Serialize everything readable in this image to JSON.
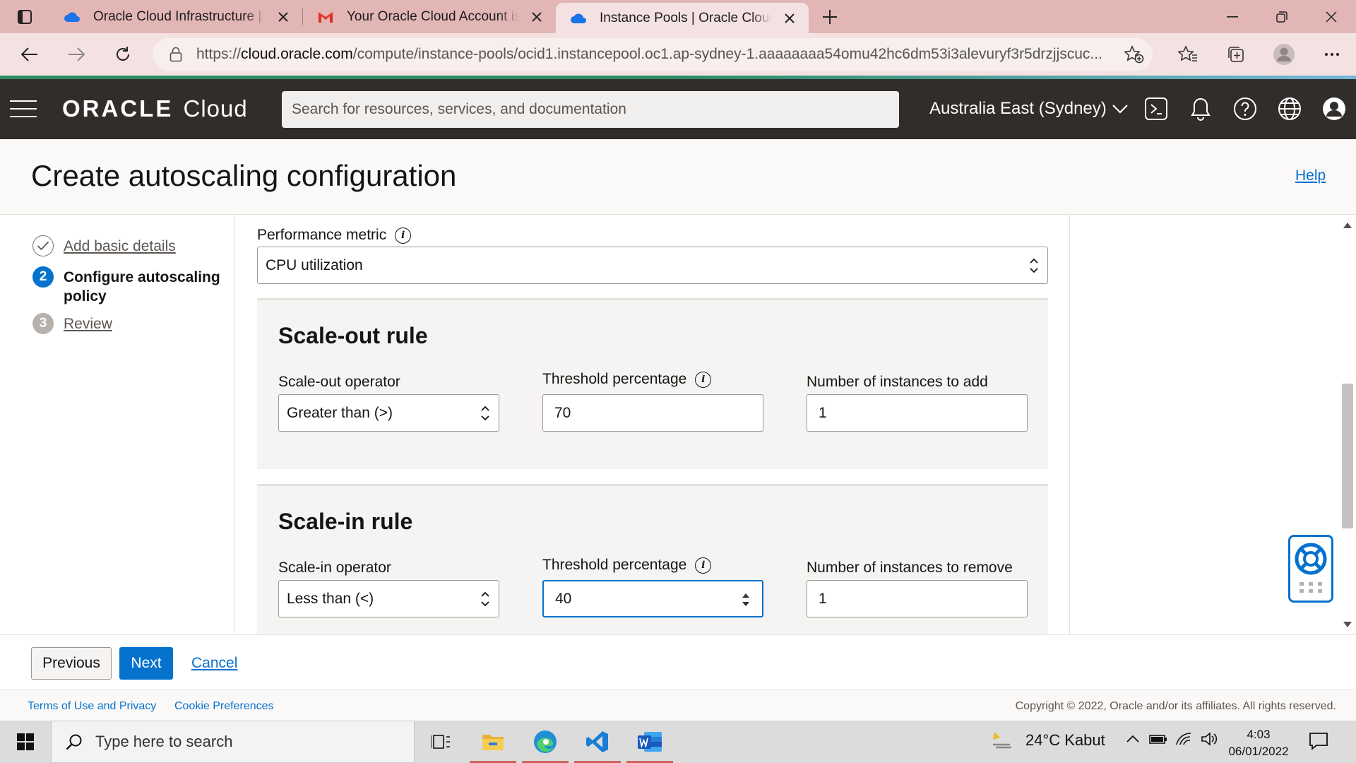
{
  "browser": {
    "tabs": [
      {
        "title": "Oracle Cloud Infrastructure | Sign In",
        "active": false,
        "icon": "cloud-icon"
      },
      {
        "title": "Your Oracle Cloud Account is Fully",
        "active": false,
        "icon": "gmail-icon"
      },
      {
        "title": "Instance Pools | Oracle Cloud Infrastructure",
        "active": true,
        "icon": "cloud-icon"
      }
    ],
    "url_prefix": "https://",
    "url_domain": "cloud.oracle.com",
    "url_path": "/compute/instance-pools/ocid1.instancepool.oc1.ap-sydney-1.aaaaaaaa54omu42hc6dm53i3alevuryf3r5drzjjscuc..."
  },
  "header": {
    "logo_oracle": "ORACLE",
    "logo_cloud": "Cloud",
    "search_placeholder": "Search for resources, services, and documentation",
    "region": "Australia East (Sydney)"
  },
  "page": {
    "title": "Create autoscaling configuration",
    "help": "Help"
  },
  "steps": [
    {
      "number": "",
      "label": "Add basic details",
      "state": "done"
    },
    {
      "number": "2",
      "label": "Configure autoscaling policy",
      "state": "current"
    },
    {
      "number": "3",
      "label": "Review",
      "state": "future"
    }
  ],
  "form": {
    "performance_metric_label": "Performance metric",
    "performance_metric_value": "CPU utilization",
    "scale_out": {
      "title": "Scale-out rule",
      "operator_label": "Scale-out operator",
      "operator_value": "Greater than (>)",
      "threshold_label": "Threshold percentage",
      "threshold_value": "70",
      "count_label": "Number of instances to add",
      "count_value": "1"
    },
    "scale_in": {
      "title": "Scale-in rule",
      "operator_label": "Scale-in operator",
      "operator_value": "Less than (<)",
      "threshold_label": "Threshold percentage",
      "threshold_value": "40",
      "count_label": "Number of instances to remove",
      "count_value": "1"
    }
  },
  "footer": {
    "previous": "Previous",
    "next": "Next",
    "cancel": "Cancel",
    "terms": "Terms of Use and Privacy",
    "cookies": "Cookie Preferences",
    "copyright": "Copyright © 2022, Oracle and/or its affiliates. All rights reserved."
  },
  "taskbar": {
    "search_placeholder": "Type here to search",
    "weather": "24°C  Kabut",
    "time": "4:03",
    "date": "06/01/2022"
  },
  "colors": {
    "brand_blue": "#0572ce",
    "header_bg": "#312d2a",
    "tabbar_bg": "#e3b6b6"
  }
}
